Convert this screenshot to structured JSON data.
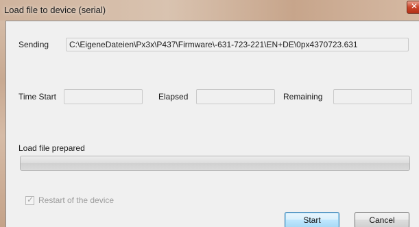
{
  "window": {
    "title": "Load file to device (serial)"
  },
  "sending": {
    "label": "Sending",
    "path": "C:\\EigeneDateien\\Px3x\\P437\\Firmware\\-631-723-221\\EN+DE\\0px4370723.631"
  },
  "times": {
    "start_label": "Time Start",
    "start_value": "",
    "elapsed_label": "Elapsed",
    "elapsed_value": "",
    "remaining_label": "Remaining",
    "remaining_value": ""
  },
  "status": {
    "text": "Load file prepared",
    "progress_fraction": 0
  },
  "restart": {
    "label": "Restart of the device",
    "checked": true,
    "enabled": false
  },
  "buttons": {
    "start_label": "Start",
    "cancel_label": "Cancel"
  },
  "colors": {
    "title_bar": "#cfb39d",
    "client_bg": "#f0f0f0",
    "close_button": "#c9452a",
    "default_button_border": "#3c7fb1"
  }
}
